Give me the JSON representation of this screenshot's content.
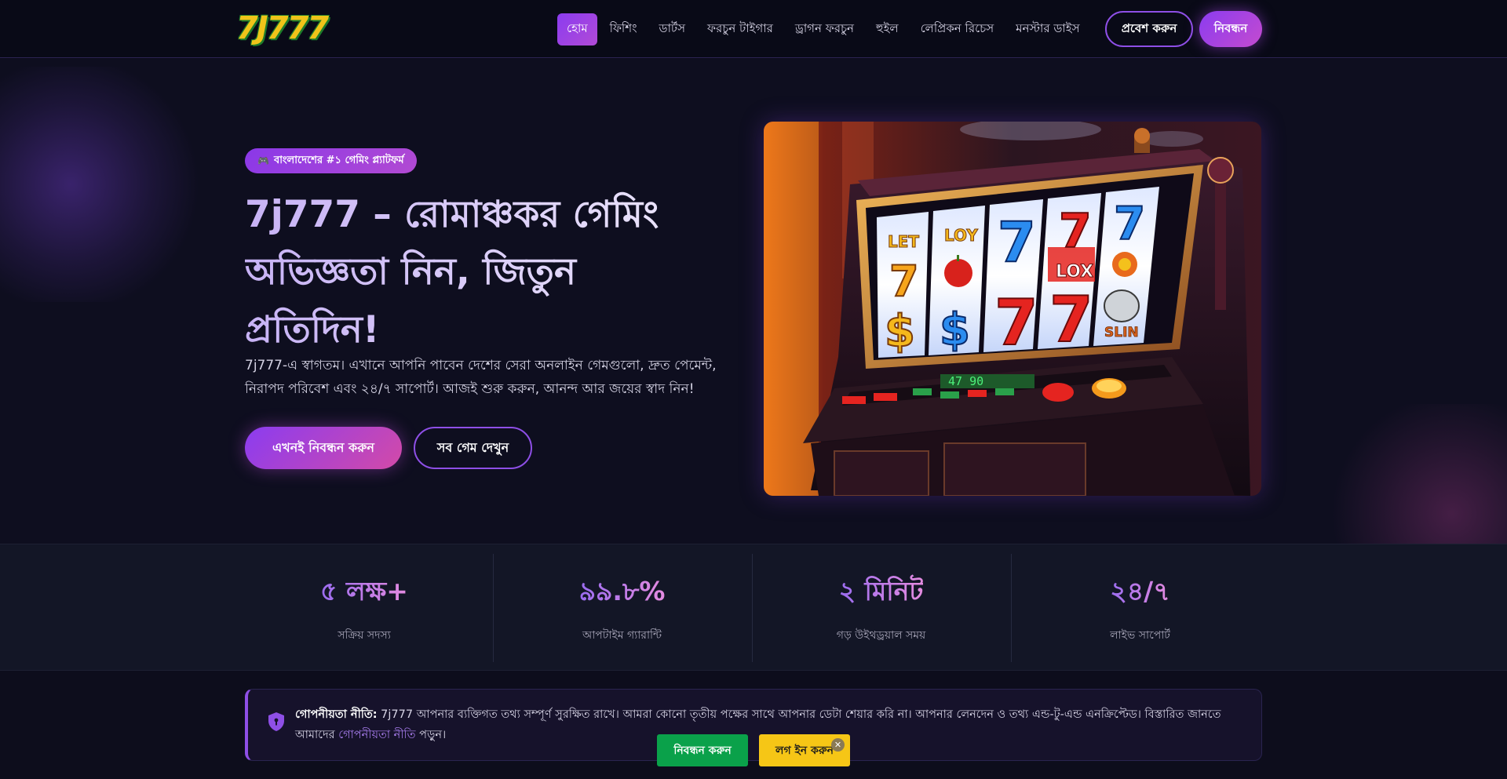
{
  "header": {
    "logo_text": "7J777",
    "nav": [
      {
        "label": "হোম",
        "active": true
      },
      {
        "label": "ফিশিং"
      },
      {
        "label": "ডার্টস"
      },
      {
        "label": "ফরচুন টাইগার"
      },
      {
        "label": "ড্রাগন ফরচুন"
      },
      {
        "label": "হুইল"
      },
      {
        "label": "লেপ্রিকন রিচেস"
      },
      {
        "label": "মনস্টার ডাইস"
      }
    ],
    "login_label": "প্রবেশ করুন",
    "register_label": "নিবন্ধন"
  },
  "hero": {
    "badge": "বাংলাদেশের #১ গেমিং প্ল্যাটফর্ম",
    "badge_icon": "gamepad-icon",
    "title": "7j777 – রোমাঞ্চকর গেমিং অভিজ্ঞতা নিন, জিতুন প্রতিদিন!",
    "description": "7j777-এ স্বাগতম। এখানে আপনি পাবেন দেশের সেরা অনলাইন গেমগুলো, দ্রুত পেমেন্ট, নিরাপদ পরিবেশ এবং ২৪/৭ সাপোর্ট। আজই শুরু করুন, আনন্দ আর জয়ের স্বাদ নিন!",
    "primary_cta": "এখনই নিবন্ধন করুন",
    "secondary_cta": "সব গেম দেখুন",
    "image": {
      "reels": [
        [
          "LET",
          "7",
          "$"
        ],
        [
          "LOY",
          "🍎",
          "$"
        ],
        [
          "7",
          "",
          "7"
        ],
        [
          "7",
          "LOX",
          "7"
        ],
        [
          "7",
          "",
          "SLIN"
        ]
      ],
      "counter": "47 90"
    }
  },
  "stats": [
    {
      "value": "৫ লক্ষ+",
      "label": "সক্রিয় সদস্য"
    },
    {
      "value": "৯৯.৮%",
      "label": "আপটাইম গ্যারান্টি"
    },
    {
      "value": "২ মিনিট",
      "label": "গড় উইথড্রয়াল সময়"
    },
    {
      "value": "২৪/৭",
      "label": "লাইভ সাপোর্ট"
    }
  ],
  "privacy": {
    "heading": "গোপনীয়তা নীতি:",
    "text_before_link": " 7j777 আপনার ব্যক্তিগত তথ্য সম্পূর্ণ সুরক্ষিত রাখে। আমরা কোনো তৃতীয় পক্ষের সাথে আপনার ডেটা শেয়ার করি না। আপনার লেনদেন ও তথ্য এন্ড-টু-এন্ড এনক্রিপ্টেড। বিস্তারিত জানতে আমাদের ",
    "link": "গোপনীয়তা নীতি",
    "text_after_link": " পড়ুন।",
    "icon": "shield-icon"
  },
  "floating_bar": {
    "register_label": "নিবন্ধন করুন",
    "login_label": "লগ ইন করুন",
    "close_glyph": "✕"
  },
  "colors": {
    "accent": "#8b3cf0",
    "accent_pink": "#d34aa8",
    "background": "#0d0d1c",
    "float_register": "#0aa14a",
    "float_login": "#f6c616"
  }
}
